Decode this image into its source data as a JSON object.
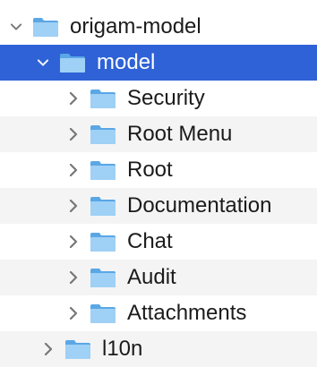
{
  "tree": {
    "root": {
      "label": "origam-model",
      "expanded": true,
      "icon": "folder-icon"
    },
    "model": {
      "label": "model",
      "expanded": true,
      "selected": true,
      "icon": "folder-icon"
    },
    "children": [
      {
        "label": "Security",
        "icon": "folder-icon"
      },
      {
        "label": "Root Menu",
        "icon": "folder-icon"
      },
      {
        "label": "Root",
        "icon": "folder-icon"
      },
      {
        "label": "Documentation",
        "icon": "folder-icon"
      },
      {
        "label": "Chat",
        "icon": "folder-icon"
      },
      {
        "label": "Audit",
        "icon": "folder-icon"
      },
      {
        "label": "Attachments",
        "icon": "folder-icon"
      }
    ],
    "sibling": {
      "label": "l10n",
      "expanded": false,
      "icon": "folder-icon"
    }
  },
  "colors": {
    "selection": "#2f62d6",
    "stripe": "#f4f4f5",
    "folder_light": "#9fd0f5",
    "folder_dark": "#5aa7e6",
    "text": "#1b1b1b"
  }
}
